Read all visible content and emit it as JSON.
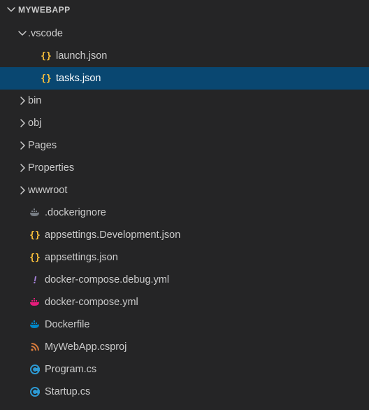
{
  "explorer": {
    "title": "MYWEBAPP",
    "expanded": true
  },
  "tree": {
    "vscode_folder": {
      "label": ".vscode",
      "expanded": true
    },
    "launch_json": {
      "label": "launch.json"
    },
    "tasks_json": {
      "label": "tasks.json",
      "selected": true
    },
    "bin_folder": {
      "label": "bin"
    },
    "obj_folder": {
      "label": "obj"
    },
    "pages_folder": {
      "label": "Pages"
    },
    "properties_folder": {
      "label": "Properties"
    },
    "wwwroot_folder": {
      "label": "wwwroot"
    },
    "dockerignore": {
      "label": ".dockerignore"
    },
    "appsettings_dev": {
      "label": "appsettings.Development.json"
    },
    "appsettings": {
      "label": "appsettings.json"
    },
    "docker_compose_debug": {
      "label": "docker-compose.debug.yml"
    },
    "docker_compose": {
      "label": "docker-compose.yml"
    },
    "dockerfile": {
      "label": "Dockerfile"
    },
    "csproj": {
      "label": "MyWebApp.csproj"
    },
    "program_cs": {
      "label": "Program.cs"
    },
    "startup_cs": {
      "label": "Startup.cs"
    }
  },
  "icons": {
    "json_color": "#fac03b",
    "docker_grey": "#777d84",
    "docker_pink": "#e61c7c",
    "docker_blue": "#0087c9",
    "exclaim_color": "#a480d8",
    "rss_color": "#d67a3c",
    "cs_color": "#2d9ad4"
  }
}
